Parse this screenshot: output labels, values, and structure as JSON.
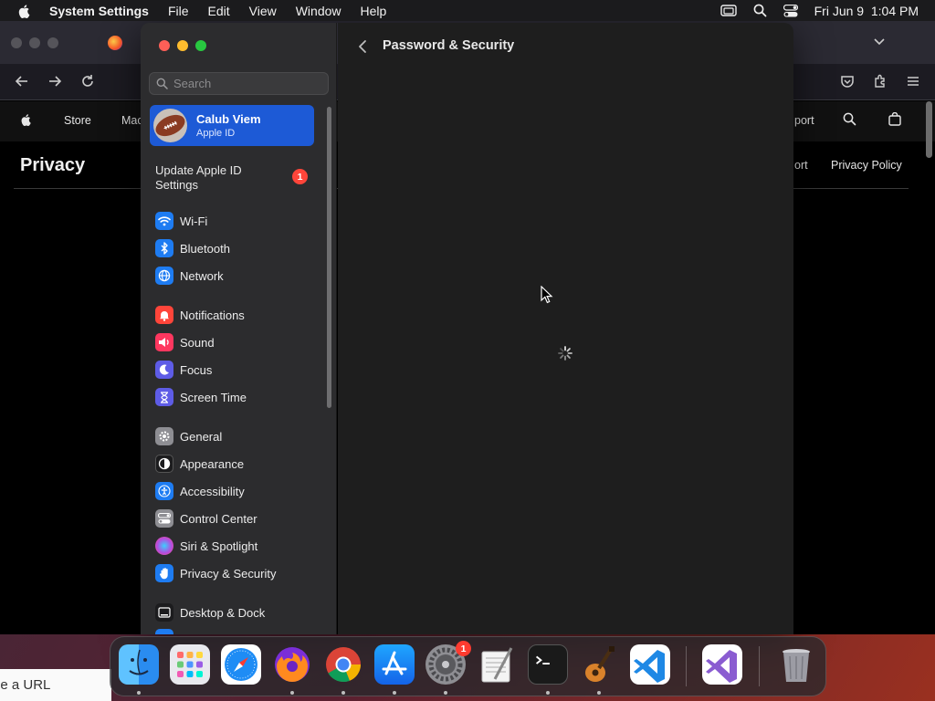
{
  "menubar": {
    "app_name": "System Settings",
    "items": [
      "File",
      "Edit",
      "View",
      "Window",
      "Help"
    ],
    "clock": "Fri Jun 9  1:04 PM"
  },
  "browser": {
    "site_nav": {
      "store": "Store",
      "mac_partial": "Mac",
      "support_partial": "port"
    },
    "page_heading": "Privacy",
    "sub_links": {
      "support_partial": "ort",
      "privacy_policy": "Privacy Policy"
    },
    "url_placeholder_partial": "pe a URL"
  },
  "settings": {
    "search_placeholder": "Search",
    "account": {
      "name": "Calub Viem",
      "subtitle": "Apple ID"
    },
    "update_row": {
      "label": "Update Apple ID Settings",
      "badge": "1"
    },
    "sidebar_items": [
      {
        "label": "Wi-Fi",
        "icon": "wifi-icon",
        "color": "#1e7cf2"
      },
      {
        "label": "Bluetooth",
        "icon": "bluetooth-icon",
        "color": "#1e7cf2"
      },
      {
        "label": "Network",
        "icon": "globe-icon",
        "color": "#1e7cf2"
      },
      {
        "label": "Notifications",
        "icon": "bell-icon",
        "color": "#ff453a"
      },
      {
        "label": "Sound",
        "icon": "speaker-icon",
        "color": "#ff375f"
      },
      {
        "label": "Focus",
        "icon": "moon-icon",
        "color": "#5e5ce6"
      },
      {
        "label": "Screen Time",
        "icon": "hourglass-icon",
        "color": "#5e5ce6"
      },
      {
        "label": "General",
        "icon": "gear-icon",
        "color": "#8e8e93"
      },
      {
        "label": "Appearance",
        "icon": "appearance-icon",
        "color": "#1c1c1e"
      },
      {
        "label": "Accessibility",
        "icon": "accessibility-icon",
        "color": "#1e7cf2"
      },
      {
        "label": "Control Center",
        "icon": "control-center-icon",
        "color": "#8e8e93"
      },
      {
        "label": "Siri & Spotlight",
        "icon": "siri-icon",
        "color": "#b34ee0"
      },
      {
        "label": "Privacy & Security",
        "icon": "hand-icon",
        "color": "#1e7cf2"
      },
      {
        "label": "Desktop & Dock",
        "icon": "desktop-icon",
        "color": "#1c1c1e"
      }
    ],
    "content_title": "Password & Security"
  },
  "dock": {
    "settings_badge": "1"
  }
}
